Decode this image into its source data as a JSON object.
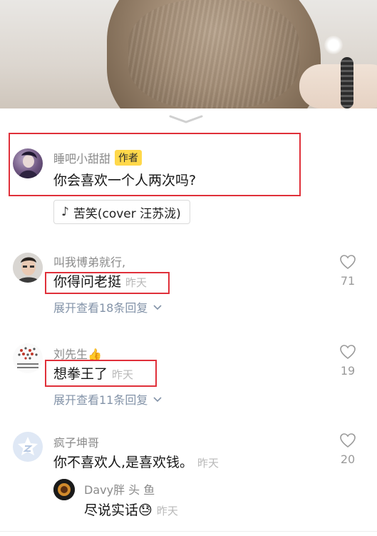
{
  "author_comment": {
    "username": "睡吧小甜甜",
    "badge": "作者",
    "text": "你会喜欢一个人两次吗?",
    "music": "苦笑(cover 汪苏泷)"
  },
  "comments": [
    {
      "username": "叫我博弟就行,",
      "text": "你得问老挺",
      "time": "昨天",
      "expand": "展开查看18条回复",
      "likes": "71"
    },
    {
      "username": "刘先生👍",
      "text": "想拳王了",
      "time": "昨天",
      "expand": "展开查看11条回复",
      "likes": "19"
    },
    {
      "username": "疯子坤哥",
      "text": "你不喜欢人,是喜欢钱。",
      "time": "昨天",
      "likes": "20",
      "reply": {
        "username": "Davy胖 头 鱼",
        "text": "尽说实话😓",
        "time": "昨天"
      }
    }
  ],
  "colors": {
    "highlight_box": "#e0303a",
    "author_badge": "#ffd84a",
    "expand_link": "#8393a8"
  },
  "icons": [
    "chevron-down-icon",
    "music-note-icon",
    "heart-outline-icon",
    "star-avatar-icon"
  ]
}
